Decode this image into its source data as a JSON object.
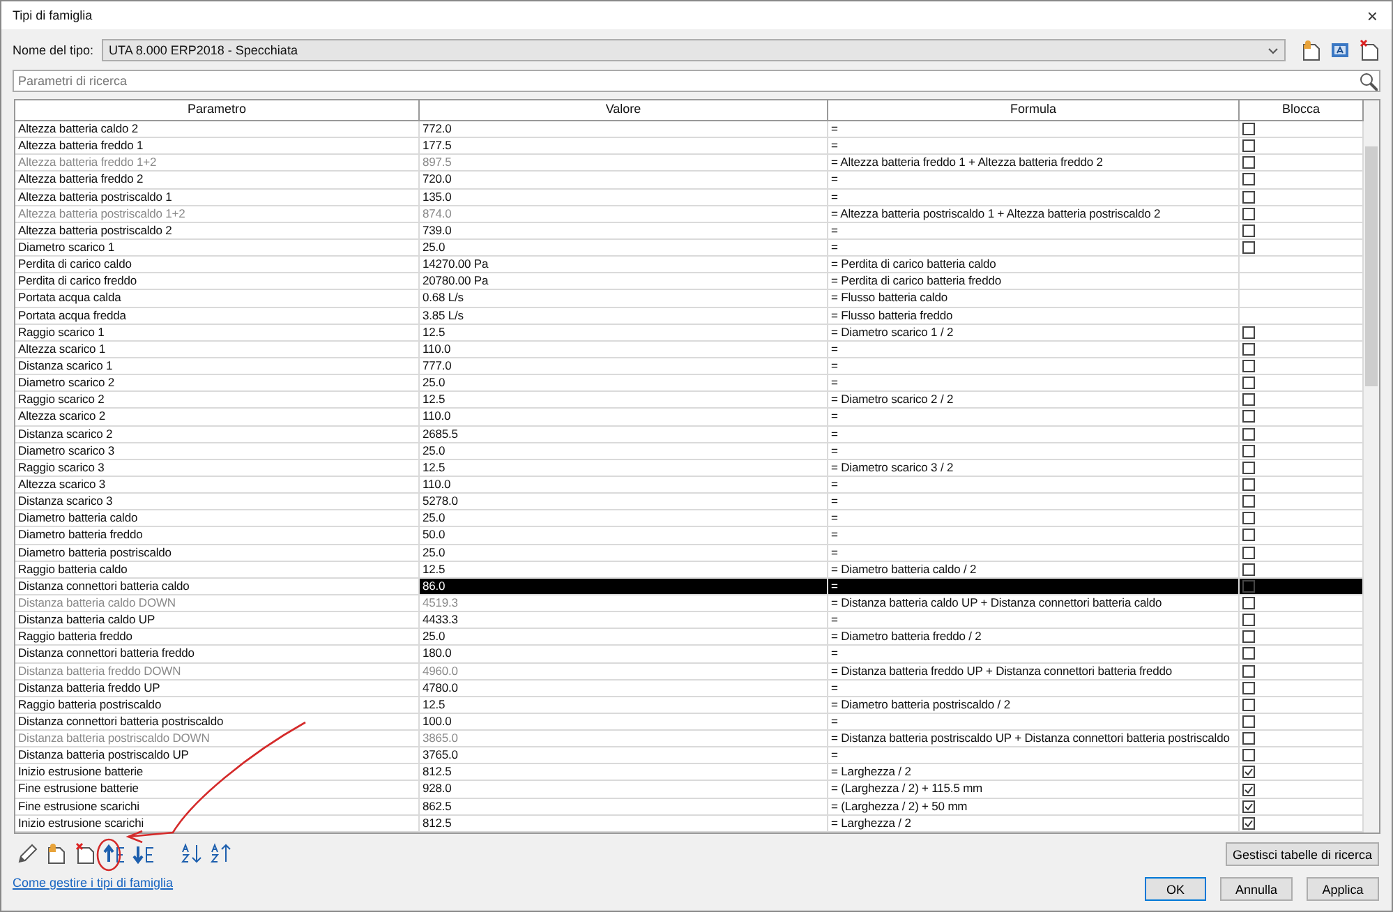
{
  "window": {
    "title": "Tipi di famiglia",
    "close": "×"
  },
  "type_name": {
    "label": "Nome del tipo:",
    "value": "UTA 8.000 ERP2018 - Specchiata"
  },
  "search": {
    "placeholder": "Parametri di ricerca"
  },
  "table": {
    "columns": [
      "Parametro",
      "Valore",
      "Formula",
      "Blocca"
    ],
    "rows": [
      {
        "parameter": "Altezza batteria caldo 2",
        "value": "772.0",
        "formula": "=",
        "locked": false,
        "disabled": false,
        "selected": false
      },
      {
        "parameter": "Altezza batteria freddo 1",
        "value": "177.5",
        "formula": "=",
        "locked": false,
        "disabled": false,
        "selected": false
      },
      {
        "parameter": "Altezza batteria freddo 1+2",
        "value": "897.5",
        "formula": "= Altezza batteria freddo 1 + Altezza batteria freddo 2",
        "locked": false,
        "disabled": true,
        "selected": false
      },
      {
        "parameter": "Altezza batteria freddo 2",
        "value": "720.0",
        "formula": "=",
        "locked": false,
        "disabled": false,
        "selected": false
      },
      {
        "parameter": "Altezza batteria postriscaldo 1",
        "value": "135.0",
        "formula": "=",
        "locked": false,
        "disabled": false,
        "selected": false
      },
      {
        "parameter": "Altezza batteria postriscaldo 1+2",
        "value": "874.0",
        "formula": "= Altezza batteria postriscaldo 1 + Altezza batteria postriscaldo 2",
        "locked": false,
        "disabled": true,
        "selected": false
      },
      {
        "parameter": "Altezza batteria postriscaldo 2",
        "value": "739.0",
        "formula": "=",
        "locked": false,
        "disabled": false,
        "selected": false
      },
      {
        "parameter": "Diametro scarico 1",
        "value": "25.0",
        "formula": "=",
        "locked": false,
        "disabled": false,
        "selected": false
      },
      {
        "parameter": "Perdita di carico caldo",
        "value": "14270.00 Pa",
        "formula": "= Perdita di carico batteria caldo",
        "disabled": false,
        "selected": false
      },
      {
        "parameter": "Perdita di carico freddo",
        "value": "20780.00 Pa",
        "formula": "= Perdita di carico batteria freddo",
        "disabled": false,
        "selected": false
      },
      {
        "parameter": "Portata acqua calda",
        "value": "0.68 L/s",
        "formula": "= Flusso batteria caldo",
        "disabled": false,
        "selected": false
      },
      {
        "parameter": "Portata acqua fredda",
        "value": "3.85 L/s",
        "formula": "= Flusso batteria freddo",
        "disabled": false,
        "selected": false
      },
      {
        "parameter": "Raggio scarico 1",
        "value": "12.5",
        "formula": "= Diametro scarico 1 / 2",
        "locked": false,
        "disabled": false,
        "selected": false
      },
      {
        "parameter": "Altezza scarico 1",
        "value": "110.0",
        "formula": "=",
        "locked": false,
        "disabled": false,
        "selected": false
      },
      {
        "parameter": "Distanza scarico 1",
        "value": "777.0",
        "formula": "=",
        "locked": false,
        "disabled": false,
        "selected": false
      },
      {
        "parameter": "Diametro scarico 2",
        "value": "25.0",
        "formula": "=",
        "locked": false,
        "disabled": false,
        "selected": false
      },
      {
        "parameter": "Raggio scarico 2",
        "value": "12.5",
        "formula": "= Diametro scarico 2 / 2",
        "locked": false,
        "disabled": false,
        "selected": false
      },
      {
        "parameter": "Altezza scarico 2",
        "value": "110.0",
        "formula": "=",
        "locked": false,
        "disabled": false,
        "selected": false
      },
      {
        "parameter": "Distanza scarico 2",
        "value": "2685.5",
        "formula": "=",
        "locked": false,
        "disabled": false,
        "selected": false
      },
      {
        "parameter": "Diametro scarico 3",
        "value": "25.0",
        "formula": "=",
        "locked": false,
        "disabled": false,
        "selected": false
      },
      {
        "parameter": "Raggio scarico 3",
        "value": "12.5",
        "formula": "= Diametro scarico 3 / 2",
        "locked": false,
        "disabled": false,
        "selected": false
      },
      {
        "parameter": "Altezza scarico 3",
        "value": "110.0",
        "formula": "=",
        "locked": false,
        "disabled": false,
        "selected": false
      },
      {
        "parameter": "Distanza scarico 3",
        "value": "5278.0",
        "formula": "=",
        "locked": false,
        "disabled": false,
        "selected": false
      },
      {
        "parameter": "Diametro batteria caldo",
        "value": "25.0",
        "formula": "=",
        "locked": false,
        "disabled": false,
        "selected": false
      },
      {
        "parameter": "Diametro batteria freddo",
        "value": "50.0",
        "formula": "=",
        "locked": false,
        "disabled": false,
        "selected": false
      },
      {
        "parameter": "Diametro batteria postriscaldo",
        "value": "25.0",
        "formula": "=",
        "locked": false,
        "disabled": false,
        "selected": false
      },
      {
        "parameter": "Raggio batteria caldo",
        "value": "12.5",
        "formula": "= Diametro batteria caldo / 2",
        "locked": false,
        "disabled": false,
        "selected": false
      },
      {
        "parameter": "Distanza connettori batteria caldo",
        "value": "86.0",
        "formula": "=",
        "locked": false,
        "disabled": false,
        "selected": true
      },
      {
        "parameter": "Distanza batteria caldo DOWN",
        "value": "4519.3",
        "formula": "= Distanza batteria caldo UP + Distanza connettori batteria caldo",
        "locked": false,
        "disabled": true,
        "selected": false
      },
      {
        "parameter": "Distanza batteria caldo UP",
        "value": "4433.3",
        "formula": "=",
        "locked": false,
        "disabled": false,
        "selected": false
      },
      {
        "parameter": "Raggio batteria freddo",
        "value": "25.0",
        "formula": "= Diametro batteria freddo / 2",
        "locked": false,
        "disabled": false,
        "selected": false
      },
      {
        "parameter": "Distanza connettori batteria freddo",
        "value": "180.0",
        "formula": "=",
        "locked": false,
        "disabled": false,
        "selected": false
      },
      {
        "parameter": "Distanza batteria freddo DOWN",
        "value": "4960.0",
        "formula": "= Distanza batteria freddo UP + Distanza connettori batteria freddo",
        "locked": false,
        "disabled": true,
        "selected": false
      },
      {
        "parameter": "Distanza batteria freddo UP",
        "value": "4780.0",
        "formula": "=",
        "locked": false,
        "disabled": false,
        "selected": false
      },
      {
        "parameter": "Raggio batteria postriscaldo",
        "value": "12.5",
        "formula": "= Diametro batteria postriscaldo / 2",
        "locked": false,
        "disabled": false,
        "selected": false
      },
      {
        "parameter": "Distanza connettori batteria postriscaldo",
        "value": "100.0",
        "formula": "=",
        "locked": false,
        "disabled": false,
        "selected": false
      },
      {
        "parameter": "Distanza batteria postriscaldo DOWN",
        "value": "3865.0",
        "formula": "= Distanza batteria postriscaldo UP + Distanza connettori batteria postriscaldo",
        "locked": false,
        "disabled": true,
        "selected": false
      },
      {
        "parameter": "Distanza batteria postriscaldo UP",
        "value": "3765.0",
        "formula": "=",
        "locked": false,
        "disabled": false,
        "selected": false
      },
      {
        "parameter": "Inizio estrusione batterie",
        "value": "812.5",
        "formula": "= Larghezza / 2",
        "locked": true,
        "disabled": false,
        "selected": false
      },
      {
        "parameter": "Fine estrusione batterie",
        "value": "928.0",
        "formula": "= (Larghezza / 2) + 115.5 mm",
        "locked": true,
        "disabled": false,
        "selected": false
      },
      {
        "parameter": "Fine estrusione scarichi",
        "value": "862.5",
        "formula": "= (Larghezza / 2) + 50 mm",
        "locked": true,
        "disabled": false,
        "selected": false
      },
      {
        "parameter": "Inizio estrusione scarichi",
        "value": "812.5",
        "formula": "= Larghezza / 2",
        "locked": true,
        "disabled": false,
        "selected": false
      }
    ]
  },
  "help_link": "Come gestire i tipi di famiglia",
  "lookup_button": "Gestisci tabelle di ricerca",
  "buttons": [
    {
      "label": "OK",
      "kind": "default"
    },
    {
      "label": "Annulla",
      "kind": "normal"
    },
    {
      "label": "Applica",
      "kind": "normal"
    }
  ]
}
